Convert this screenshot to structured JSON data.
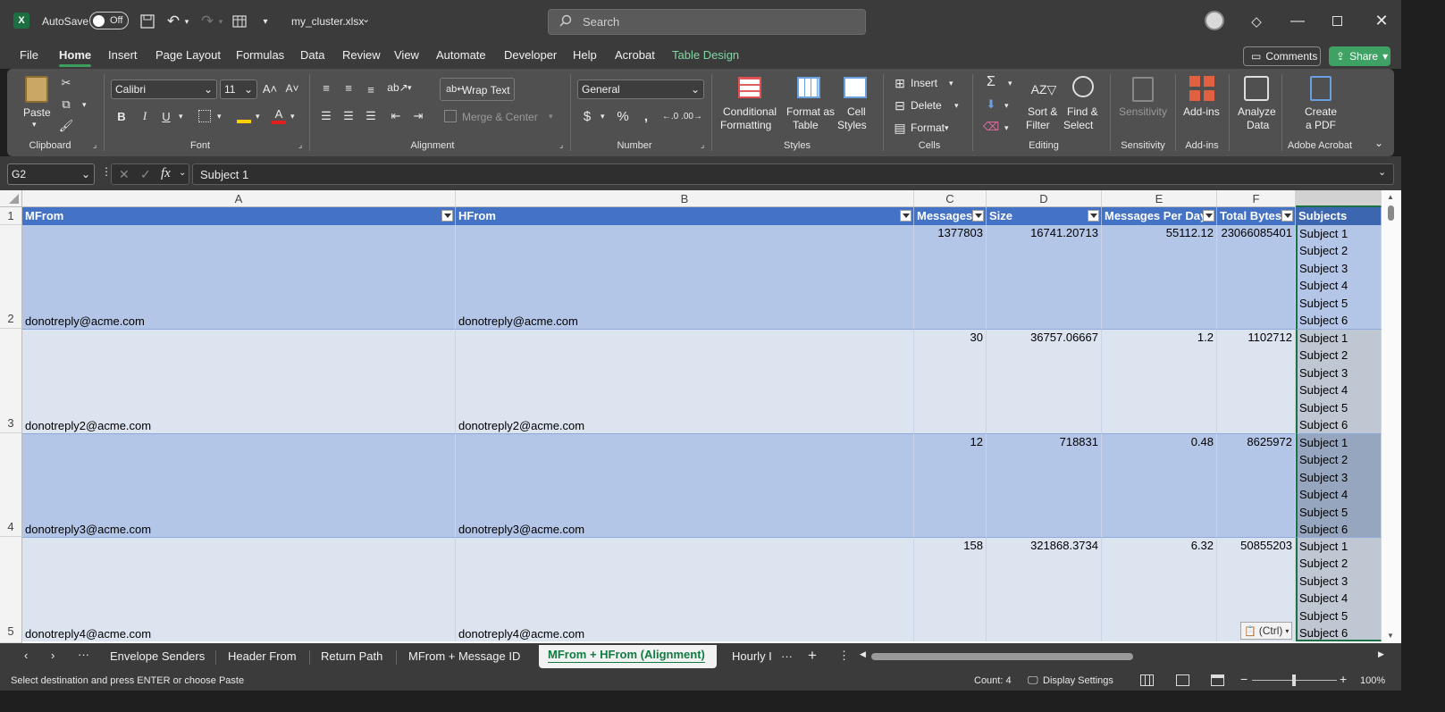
{
  "titlebar": {
    "autosave_label": "AutoSave",
    "autosave_state": "Off",
    "filename": "my_cluster.xlsx",
    "search_placeholder": "Search"
  },
  "menu": [
    "File",
    "Home",
    "Insert",
    "Page Layout",
    "Formulas",
    "Data",
    "Review",
    "View",
    "Automate",
    "Developer",
    "Help",
    "Acrobat",
    "Table Design"
  ],
  "actions": {
    "comments": "Comments",
    "share": "Share"
  },
  "ribbon": {
    "clipboard": {
      "paste": "Paste",
      "label": "Clipboard"
    },
    "font": {
      "name": "Calibri",
      "size": "11",
      "label": "Font"
    },
    "alignment": {
      "wrap": "Wrap Text",
      "merge": "Merge & Center",
      "label": "Alignment"
    },
    "number": {
      "format": "General",
      "label": "Number"
    },
    "styles": {
      "cond1": "Conditional",
      "cond2": "Formatting",
      "fmt1": "Format as",
      "fmt2": "Table",
      "cs1": "Cell",
      "cs2": "Styles",
      "label": "Styles"
    },
    "cells": {
      "insert": "Insert",
      "delete": "Delete",
      "format": "Format",
      "label": "Cells"
    },
    "editing": {
      "sort1": "Sort &",
      "sort2": "Filter",
      "find1": "Find &",
      "find2": "Select",
      "label": "Editing"
    },
    "sensitivity": {
      "btn": "Sensitivity",
      "label": "Sensitivity"
    },
    "addins": {
      "btn": "Add-ins",
      "label": "Add-ins"
    },
    "analyze": {
      "l1": "Analyze",
      "l2": "Data"
    },
    "acrobat": {
      "l1": "Create",
      "l2": "a PDF",
      "label": "Adobe Acrobat"
    }
  },
  "formula": {
    "namebox": "G2",
    "fx": "fx",
    "value": "Subject 1"
  },
  "columns": [
    "A",
    "B",
    "C",
    "D",
    "E",
    "F"
  ],
  "headers": [
    "MFrom",
    "HFrom",
    "Messages",
    "Size",
    "Messages Per Day",
    "Total Bytes",
    "Subjects"
  ],
  "rows": [
    {
      "num": "2",
      "mfrom": "donotreply@acme.com",
      "hfrom": "donotreply@acme.com",
      "messages": "1377803",
      "size": "16741.20713",
      "mpd": "55112.12",
      "bytes": "23066085401"
    },
    {
      "num": "3",
      "mfrom": "donotreply2@acme.com",
      "hfrom": "donotreply2@acme.com",
      "messages": "30",
      "size": "36757.06667",
      "mpd": "1.2",
      "bytes": "1102712"
    },
    {
      "num": "4",
      "mfrom": "donotreply3@acme.com",
      "hfrom": "donotreply3@acme.com",
      "messages": "12",
      "size": "718831",
      "mpd": "0.48",
      "bytes": "8625972"
    },
    {
      "num": "5",
      "mfrom": "donotreply4@acme.com",
      "hfrom": "donotreply4@acme.com",
      "messages": "158",
      "size": "321868.3734",
      "mpd": "6.32",
      "bytes": "50855203"
    }
  ],
  "subjects": [
    "Subject 1",
    "Subject 2",
    "Subject 3",
    "Subject 4",
    "Subject 5",
    "Subject 6"
  ],
  "paste_tag": "(Ctrl)",
  "sheets": [
    "Envelope Senders",
    "Header From",
    "Return Path",
    "MFrom + Message ID",
    "MFrom + HFrom (Alignment)",
    "Hourly I"
  ],
  "status": {
    "message": "Select destination and press ENTER or choose Paste",
    "count": "Count: 4",
    "display": "Display Settings",
    "zoom": "100%"
  }
}
